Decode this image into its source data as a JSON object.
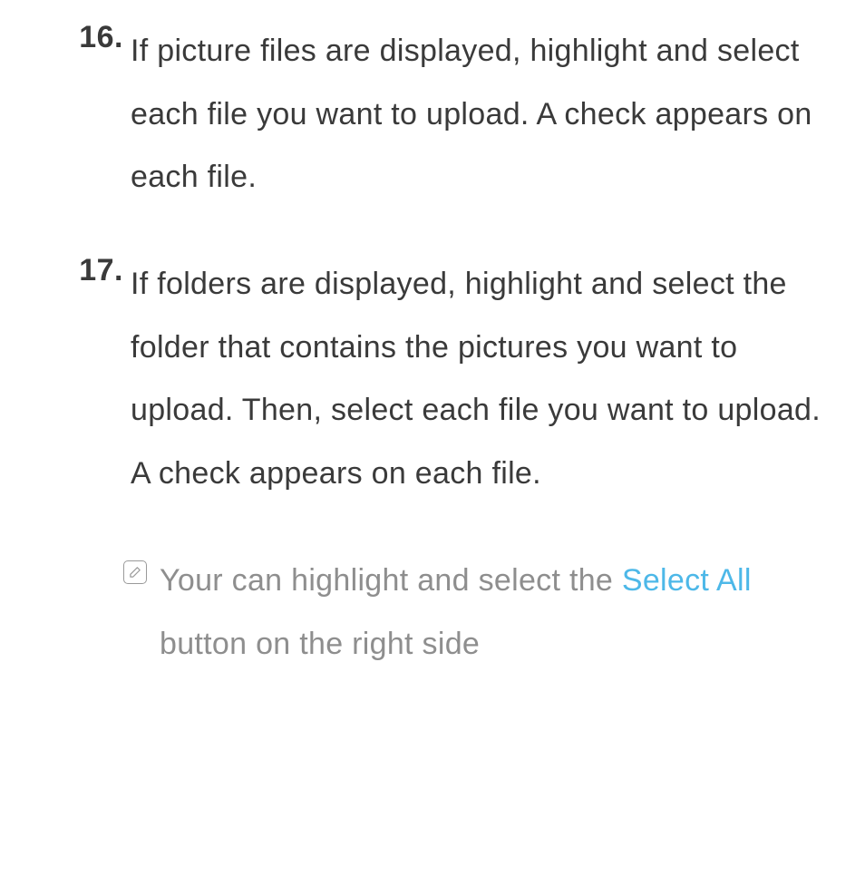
{
  "items": [
    {
      "number": "16.",
      "text": "If picture files are displayed, highlight and select each file you want to upload. A check appears on each file."
    },
    {
      "number": "17.",
      "text": "If folders are displayed, highlight and select the folder that contains the pictures you want to upload. Then, select each file you want to upload. A check appears on each file."
    }
  ],
  "note": {
    "prefix": "Your can highlight and select the ",
    "highlight": "Select All",
    "suffix": " button on the right side"
  }
}
